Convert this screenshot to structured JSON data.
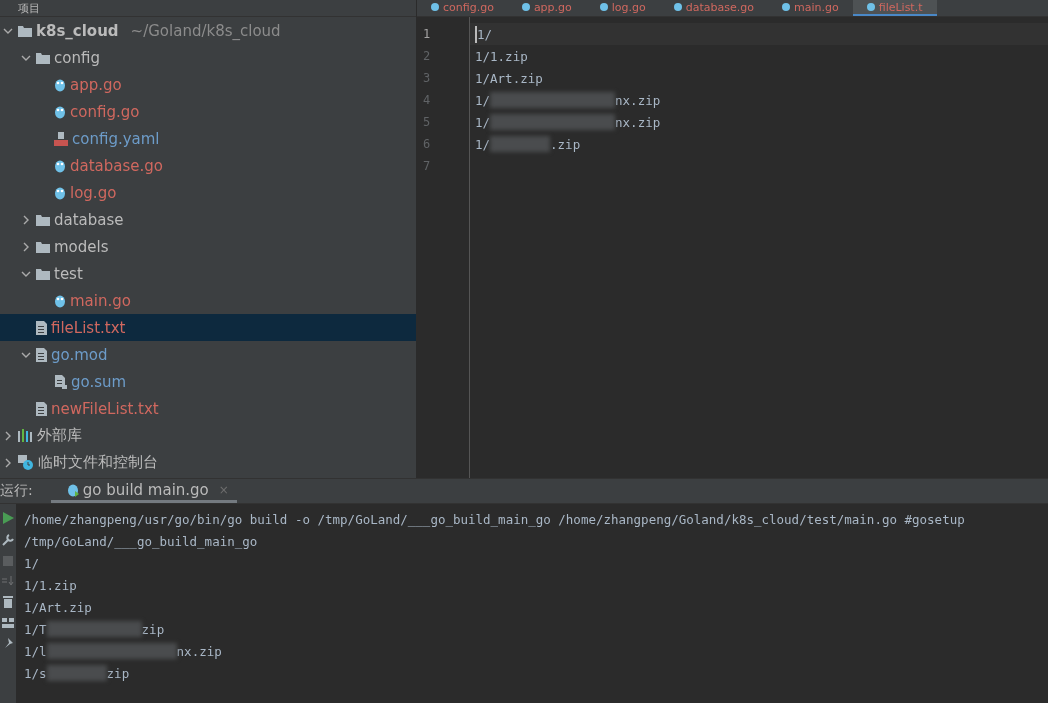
{
  "project_panel": {
    "title": "项目"
  },
  "editor_tabs": [
    {
      "label": "config.go",
      "selected": false
    },
    {
      "label": "app.go",
      "selected": false
    },
    {
      "label": "log.go",
      "selected": false
    },
    {
      "label": "database.go",
      "selected": false
    },
    {
      "label": "main.go",
      "selected": false
    },
    {
      "label": "fileList.t",
      "selected": true
    }
  ],
  "tree": [
    {
      "kind": "project",
      "name": "k8s_cloud",
      "path": "~/Goland/k8s_cloud",
      "expanded": true,
      "selected": false,
      "children": [
        {
          "kind": "folder",
          "name": "config",
          "expanded": true,
          "selected": false,
          "children": [
            {
              "kind": "go",
              "name": "app.go",
              "color": "#d0685f",
              "selected": false
            },
            {
              "kind": "go",
              "name": "config.go",
              "color": "#d0685f",
              "selected": false
            },
            {
              "kind": "yaml",
              "name": "config.yaml",
              "color": "#6d9cc9",
              "selected": false
            },
            {
              "kind": "go",
              "name": "database.go",
              "color": "#d0685f",
              "selected": false
            },
            {
              "kind": "go",
              "name": "log.go",
              "color": "#d0685f",
              "selected": false
            }
          ]
        },
        {
          "kind": "folder",
          "name": "database",
          "expanded": false,
          "selected": false
        },
        {
          "kind": "folder",
          "name": "models",
          "expanded": false,
          "selected": false
        },
        {
          "kind": "folder",
          "name": "test",
          "expanded": true,
          "selected": false,
          "children": [
            {
              "kind": "go",
              "name": "main.go",
              "color": "#d0685f",
              "selected": false
            }
          ]
        },
        {
          "kind": "text",
          "name": "fileList.txt",
          "color": "#d0685f",
          "selected": true
        },
        {
          "kind": "text",
          "name": "go.mod",
          "color": "#6d9cc9",
          "expanded": true,
          "selected": false,
          "children": [
            {
              "kind": "sum",
              "name": "go.sum",
              "color": "#6d9cc9",
              "selected": false
            }
          ]
        },
        {
          "kind": "text",
          "name": "newFileList.txt",
          "color": "#d0685f",
          "selected": false
        }
      ]
    },
    {
      "kind": "library",
      "name": "外部库",
      "expanded": false,
      "selected": false
    },
    {
      "kind": "scratch",
      "name": "临时文件和控制台",
      "expanded": false,
      "selected": false
    }
  ],
  "editor_lines": [
    {
      "number": "1",
      "before": "1/",
      "redacted": false,
      "current": true
    },
    {
      "number": "2",
      "before": "1/1.zip",
      "redacted": false,
      "current": false
    },
    {
      "number": "3",
      "before": "1/Art.zip",
      "redacted": false,
      "current": false
    },
    {
      "number": "4",
      "before": "1/",
      "redacted": true,
      "after": "nx.zip",
      "current": false
    },
    {
      "number": "5",
      "before": "1/",
      "redacted": true,
      "after": "nx.zip",
      "current": false
    },
    {
      "number": "6",
      "before": "1/",
      "redacted": true,
      "after": ".zip",
      "current": false
    },
    {
      "number": "7",
      "redacted": false,
      "current": false
    }
  ],
  "run_panel": {
    "label": "运行:",
    "tab": "go build main.go",
    "close": "×"
  },
  "console_lines": [
    {
      "before": "/home/zhangpeng/usr/go/bin/go build -o /tmp/GoLand/___go_build_main_go /home/zhangpeng/Goland/k8s_cloud/test/main.go #gosetup",
      "redacted": false
    },
    {
      "before": "/tmp/GoLand/___go_build_main_go",
      "redacted": false
    },
    {
      "before": "1/",
      "redacted": false
    },
    {
      "before": "1/1.zip",
      "redacted": false
    },
    {
      "before": "1/Art.zip",
      "redacted": false
    },
    {
      "before": "1/T",
      "redacted": true,
      "after": "zip"
    },
    {
      "before": "1/l",
      "redacted": true,
      "after": "nx.zip"
    },
    {
      "before": "1/s",
      "redacted": true,
      "after": "zip"
    }
  ]
}
